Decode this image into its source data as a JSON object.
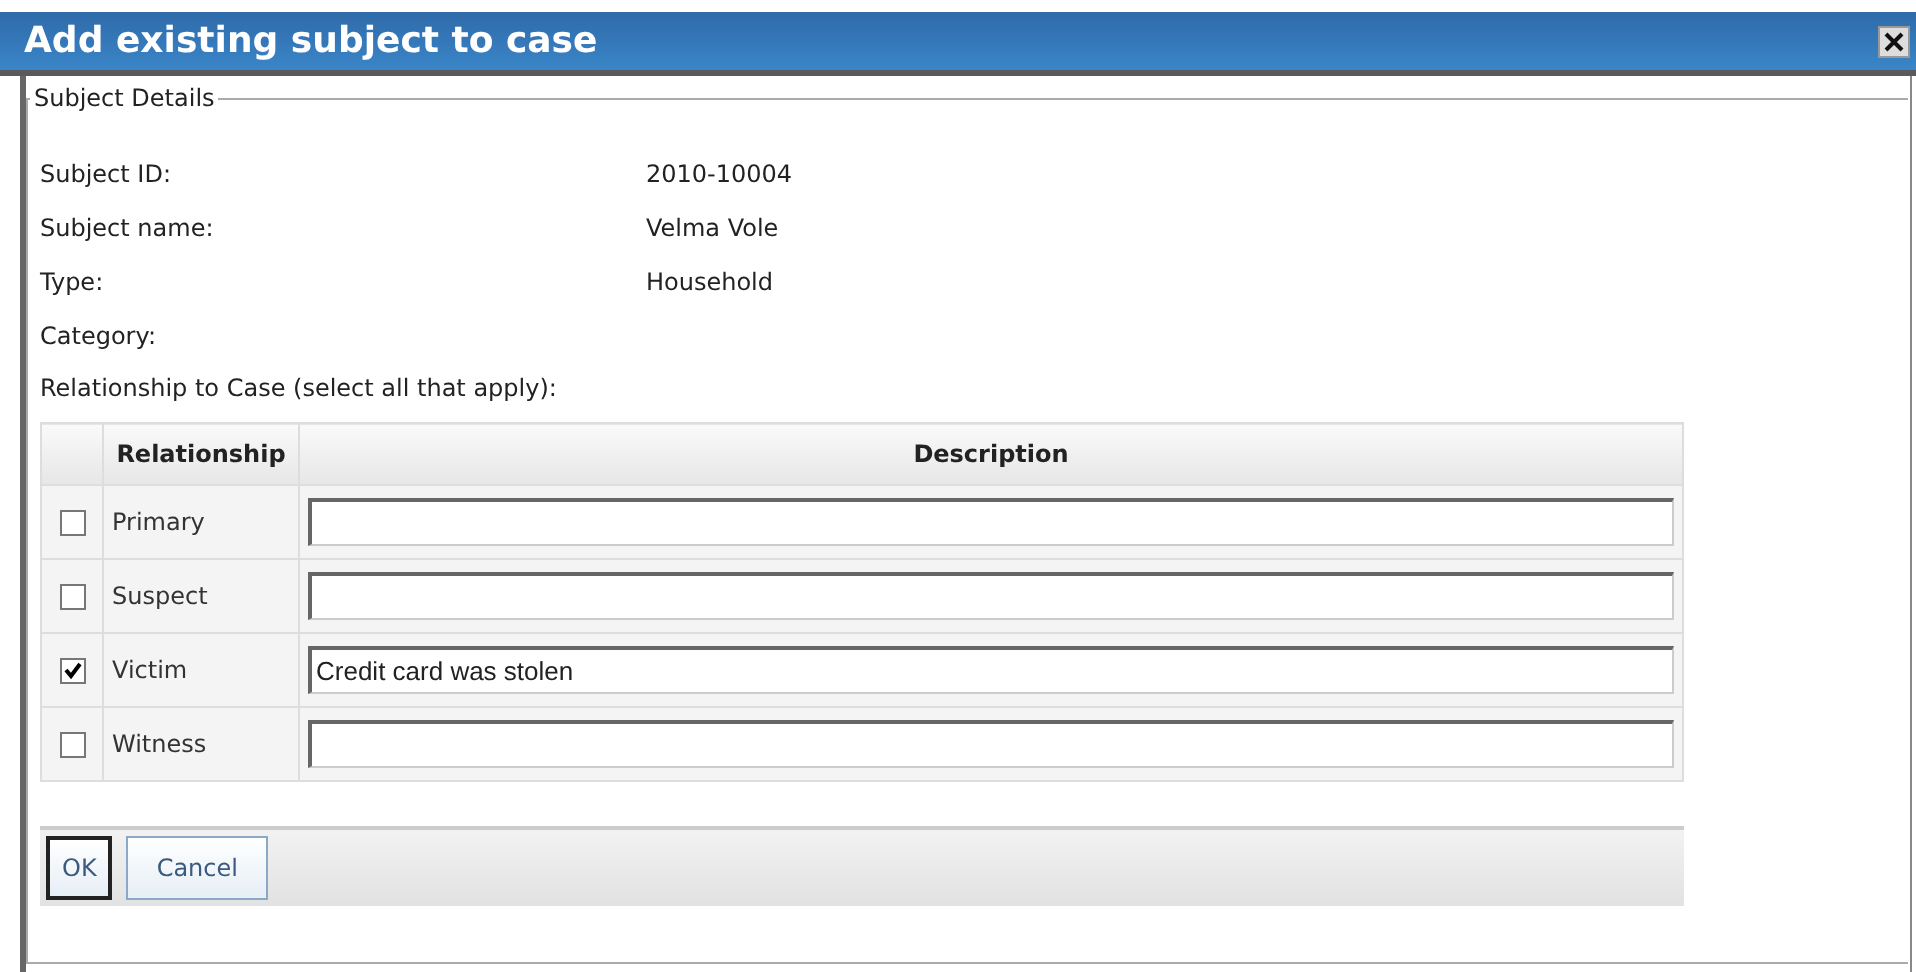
{
  "window": {
    "title": "Add existing subject to case"
  },
  "section": {
    "legend": "Subject Details"
  },
  "details": [
    {
      "label": "Subject ID:",
      "value": "2010-10004"
    },
    {
      "label": "Subject name:",
      "value": "Velma Vole"
    },
    {
      "label": "Type:",
      "value": "Household"
    },
    {
      "label": "Category:"
    }
  ],
  "relationship_prompt": "Relationship to Case (select all that apply):",
  "table": {
    "columns": [
      "Relationship",
      "Description"
    ],
    "rows": [
      {
        "relationship": "Primary",
        "checked": false
      },
      {
        "relationship": "Suspect",
        "checked": false
      },
      {
        "relationship": "Victim",
        "checked": true,
        "description": "Credit card was stolen"
      },
      {
        "relationship": "Witness",
        "checked": false
      }
    ]
  },
  "buttons": [
    {
      "label": "OK",
      "focused": true
    },
    {
      "label": "Cancel",
      "focused": false
    }
  ]
}
